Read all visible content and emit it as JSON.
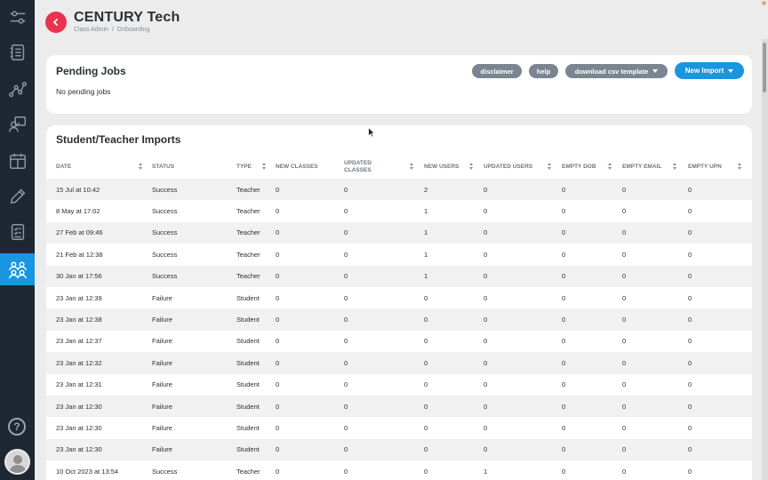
{
  "app": {
    "title": "CENTURY Tech"
  },
  "breadcrumb": {
    "first": "Class Admin",
    "separator": "/",
    "second": "Onboarding"
  },
  "sidebar": {
    "items": [
      {
        "icon": "sliders-icon"
      },
      {
        "icon": "notebook-icon"
      },
      {
        "icon": "analytics-nodes-icon"
      },
      {
        "icon": "teacher-board-icon"
      },
      {
        "icon": "calendar-icon"
      },
      {
        "icon": "pencil-icon"
      },
      {
        "icon": "checklist-icon"
      },
      {
        "icon": "users-icon",
        "active": true
      }
    ],
    "help": "?"
  },
  "pending": {
    "title": "Pending Jobs",
    "empty_text": "No pending jobs",
    "buttons": {
      "disclaimer": "disclaimer",
      "help": "help",
      "csv": "download csv template",
      "new_import": "New Import"
    }
  },
  "imports": {
    "title": "Student/Teacher Imports",
    "columns": [
      "DATE",
      "STATUS",
      "TYPE",
      "NEW CLASSES",
      "UPDATED CLASSES",
      "NEW USERS",
      "UPDATED USERS",
      "EMPTY DOB",
      "EMPTY EMAIL",
      "EMPTY UPN"
    ],
    "rows": [
      [
        "15 Jul at 10:42",
        "Success",
        "Teacher",
        "0",
        "0",
        "2",
        "0",
        "0",
        "0",
        "0"
      ],
      [
        "8 May at 17:02",
        "Success",
        "Teacher",
        "0",
        "0",
        "1",
        "0",
        "0",
        "0",
        "0"
      ],
      [
        "27 Feb at 09:46",
        "Success",
        "Teacher",
        "0",
        "0",
        "1",
        "0",
        "0",
        "0",
        "0"
      ],
      [
        "21 Feb at 12:38",
        "Success",
        "Teacher",
        "0",
        "0",
        "1",
        "0",
        "0",
        "0",
        "0"
      ],
      [
        "30 Jan at 17:56",
        "Success",
        "Teacher",
        "0",
        "0",
        "1",
        "0",
        "0",
        "0",
        "0"
      ],
      [
        "23 Jan at 12:39",
        "Failure",
        "Student",
        "0",
        "0",
        "0",
        "0",
        "0",
        "0",
        "0"
      ],
      [
        "23 Jan at 12:38",
        "Failure",
        "Student",
        "0",
        "0",
        "0",
        "0",
        "0",
        "0",
        "0"
      ],
      [
        "23 Jan at 12:37",
        "Failure",
        "Student",
        "0",
        "0",
        "0",
        "0",
        "0",
        "0",
        "0"
      ],
      [
        "23 Jan at 12:32",
        "Failure",
        "Student",
        "0",
        "0",
        "0",
        "0",
        "0",
        "0",
        "0"
      ],
      [
        "23 Jan at 12:31",
        "Failure",
        "Student",
        "0",
        "0",
        "0",
        "0",
        "0",
        "0",
        "0"
      ],
      [
        "23 Jan at 12:30",
        "Failure",
        "Student",
        "0",
        "0",
        "0",
        "0",
        "0",
        "0",
        "0"
      ],
      [
        "23 Jan at 12:30",
        "Failure",
        "Student",
        "0",
        "0",
        "0",
        "0",
        "0",
        "0",
        "0"
      ],
      [
        "23 Jan at 12:30",
        "Failure",
        "Student",
        "0",
        "0",
        "0",
        "0",
        "0",
        "0",
        "0"
      ],
      [
        "10 Oct 2023 at 13:54",
        "Success",
        "Teacher",
        "0",
        "0",
        "0",
        "1",
        "0",
        "0",
        "0"
      ]
    ]
  },
  "colors": {
    "sidebar": "#1f2733",
    "accent": "#1a95e0",
    "brand": "#e8344e",
    "pill": "#7b8591"
  }
}
